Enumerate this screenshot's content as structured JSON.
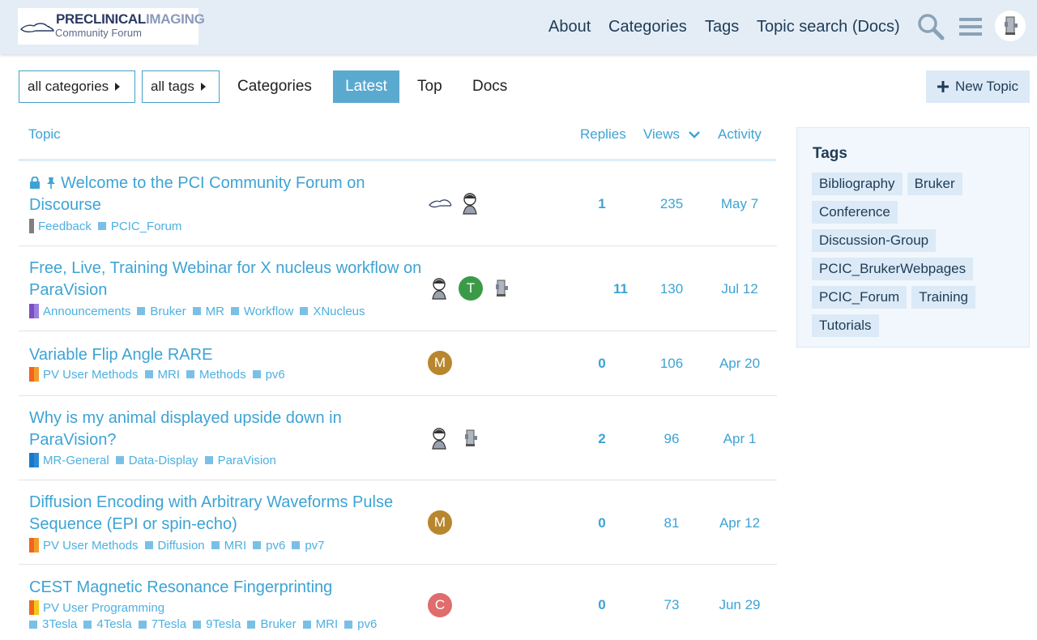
{
  "header": {
    "logo_title_bold": "PRECLINICAL",
    "logo_title_light": "IMAGING",
    "logo_subtitle": "Community Forum",
    "nav": [
      "About",
      "Categories",
      "Tags",
      "Topic search (Docs)"
    ]
  },
  "filters": {
    "categories_label": "all categories",
    "tags_label": "all tags"
  },
  "navpills": {
    "categories": "Categories",
    "latest": "Latest",
    "top": "Top",
    "docs": "Docs"
  },
  "new_topic_label": "New Topic",
  "table": {
    "columns": {
      "topic": "Topic",
      "replies": "Replies",
      "views": "Views",
      "activity": "Activity"
    }
  },
  "topics": [
    {
      "title": "Welcome to the PCI Community Forum on Discourse",
      "category": "Feedback",
      "tags": [
        "PCIC_Forum"
      ],
      "replies": "1",
      "views": "235",
      "activity": "May 7"
    },
    {
      "title": "Free, Live, Training Webinar for X nucleus workflow on ParaVision",
      "category": "Announcements",
      "tags": [
        "Bruker",
        "MR",
        "Workflow",
        "XNucleus"
      ],
      "replies": "11",
      "views": "130",
      "activity": "Jul 12"
    },
    {
      "title": "Variable Flip Angle RARE",
      "category": "PV User Methods",
      "tags": [
        "MRI",
        "Methods",
        "pv6"
      ],
      "replies": "0",
      "views": "106",
      "activity": "Apr 20"
    },
    {
      "title": "Why is my animal displayed upside down in ParaVision?",
      "category": "MR-General",
      "tags": [
        "Data-Display",
        "ParaVision"
      ],
      "replies": "2",
      "views": "96",
      "activity": "Apr 1"
    },
    {
      "title": "Diffusion Encoding with Arbitrary Waveforms Pulse Sequence (EPI or spin-echo)",
      "category": "PV User Methods",
      "tags": [
        "Diffusion",
        "MRI",
        "pv6",
        "pv7"
      ],
      "replies": "0",
      "views": "81",
      "activity": "Apr 12"
    },
    {
      "title": "CEST Magnetic Resonance Fingerprinting",
      "category": "PV User Programming",
      "tags": [
        "3Tesla",
        "4Tesla",
        "7Tesla",
        "9Tesla",
        "Bruker",
        "MRI",
        "pv6"
      ],
      "replies": "0",
      "views": "73",
      "activity": "Jun 29"
    }
  ],
  "avatars": {
    "t": "T",
    "m": "M",
    "c": "C"
  },
  "colors": {
    "accent": "#3da3d4",
    "active_pill": "#5aa9cf",
    "header_bg": "#e4edf6",
    "avatar_t": "#3a9a48",
    "avatar_m": "#b8862d",
    "avatar_c": "#e06c6c"
  },
  "sidebar": {
    "title": "Tags",
    "tags": [
      "Bibliography",
      "Bruker",
      "Conference",
      "Discussion-Group",
      "PCIC_BrukerWebpages",
      "PCIC_Forum",
      "Training",
      "Tutorials"
    ]
  }
}
